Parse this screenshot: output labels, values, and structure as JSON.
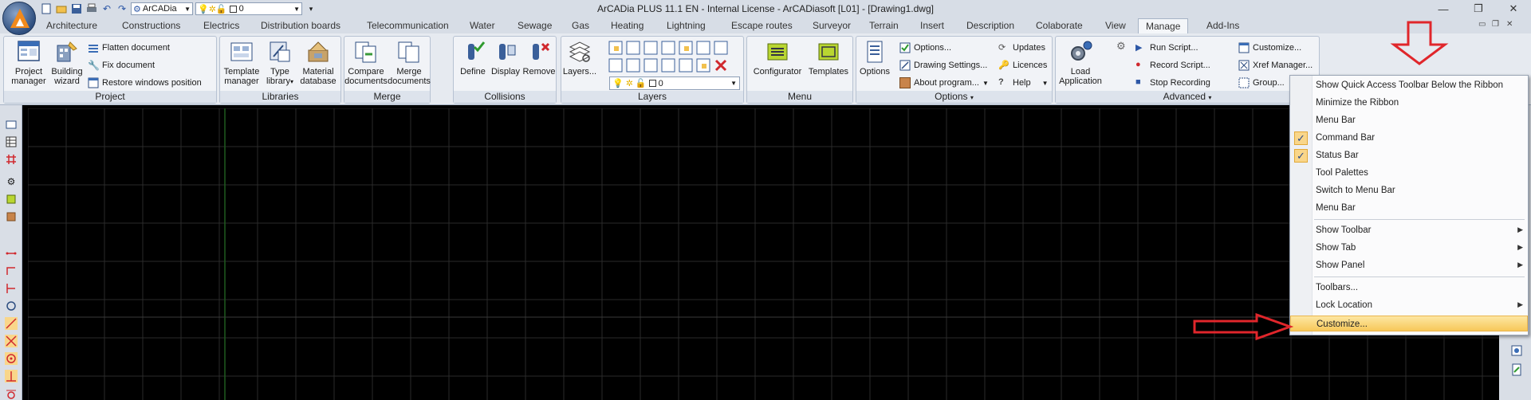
{
  "window": {
    "title": "ArCADia PLUS 11.1 EN - Internal License - ArCADiasoft [L01] - [Drawing1.dwg]",
    "minimize_glyph": "—",
    "restore_glyph": "❐",
    "close_glyph": "✕"
  },
  "quick_access": {
    "profile_combo": "ArCADia",
    "layer_combo": "0"
  },
  "tabs": [
    {
      "label": "Architecture"
    },
    {
      "label": "Constructions"
    },
    {
      "label": "Electrics"
    },
    {
      "label": "Distribution boards"
    },
    {
      "label": "Telecommunication"
    },
    {
      "label": "Water"
    },
    {
      "label": "Sewage"
    },
    {
      "label": "Gas"
    },
    {
      "label": "Heating"
    },
    {
      "label": "Lightning"
    },
    {
      "label": "Escape routes"
    },
    {
      "label": "Surveyor"
    },
    {
      "label": "Terrain"
    },
    {
      "label": "Insert"
    },
    {
      "label": "Description"
    },
    {
      "label": "Colaborate"
    },
    {
      "label": "View"
    },
    {
      "label": "Manage"
    },
    {
      "label": "Add-Ins"
    }
  ],
  "active_tab": "Manage",
  "ribbon": {
    "project": {
      "label": "Project",
      "project_manager": "Project manager",
      "building_wizard": "Building wizard",
      "flatten_document": "Flatten document",
      "fix_document": "Fix document",
      "restore_windows_position": "Restore windows position"
    },
    "libraries": {
      "label": "Libraries",
      "template_manager": "Template manager",
      "type_library": "Type library",
      "material_database": "Material database"
    },
    "merge": {
      "label": "Merge",
      "compare_documents": "Compare documents",
      "merge_documents": "Merge documents"
    },
    "collisions": {
      "label": "Collisions",
      "define": "Define",
      "display": "Display",
      "remove": "Remove"
    },
    "layers": {
      "label": "Layers",
      "layers_button": "Layers...",
      "layer_combo": "0"
    },
    "menu": {
      "label": "Menu",
      "configurator": "Configurator",
      "templates": "Templates"
    },
    "options": {
      "label": "Options",
      "options_big": "Options",
      "options_small": "Options...",
      "drawing_settings": "Drawing Settings...",
      "about_program": "About program...",
      "updates": "Updates",
      "licences": "Licences",
      "help": "Help"
    },
    "advanced": {
      "label": "Advanced",
      "load_application": "Load Application",
      "run_script": "Run Script...",
      "record_script": "Record Script...",
      "stop_recording": "Stop Recording",
      "customize": "Customize...",
      "xref_manager": "Xref Manager...",
      "group": "Group..."
    }
  },
  "context_menu": {
    "items": [
      {
        "label": "Show Quick Access Toolbar Below the Ribbon",
        "checked": false,
        "submenu": false
      },
      {
        "label": "Minimize the Ribbon",
        "checked": false,
        "submenu": false
      },
      {
        "label": "Menu Bar",
        "checked": false,
        "submenu": false
      },
      {
        "label": "Command Bar",
        "checked": true,
        "submenu": false
      },
      {
        "label": "Status Bar",
        "checked": true,
        "submenu": false
      },
      {
        "label": "Tool Palettes",
        "checked": false,
        "submenu": false
      },
      {
        "label": "Switch to Menu Bar",
        "checked": false,
        "submenu": false
      },
      {
        "label": "Menu Bar",
        "checked": false,
        "submenu": false
      },
      {
        "label": "Show Toolbar",
        "checked": false,
        "submenu": true
      },
      {
        "label": "Show Tab",
        "checked": false,
        "submenu": true
      },
      {
        "label": "Show Panel",
        "checked": false,
        "submenu": true
      },
      {
        "label": "Toolbars...",
        "checked": false,
        "submenu": false
      },
      {
        "label": "Lock Location",
        "checked": false,
        "submenu": true
      },
      {
        "label": "Customize...",
        "checked": false,
        "submenu": false,
        "highlighted": true
      }
    ]
  },
  "colors": {
    "accent_highlight": "#f7c85a",
    "annotation_red": "#e0262b",
    "canvas_bg": "#000000",
    "grid_line": "#2a2a2a",
    "y_axis": "#1f5a1f"
  }
}
